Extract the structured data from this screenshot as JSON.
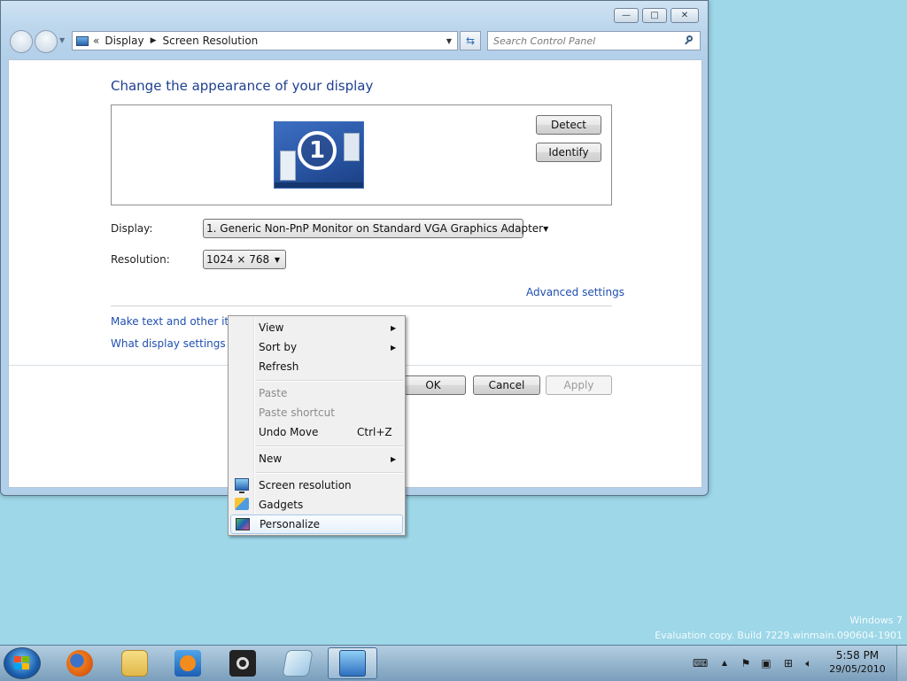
{
  "window": {
    "controls": {
      "minimize": "—",
      "maximize": "□",
      "close": "✕"
    },
    "address": {
      "chevron": "«",
      "breadcrumbs": [
        "Display",
        "Screen Resolution"
      ]
    },
    "search": {
      "placeholder": "Search Control Panel"
    }
  },
  "content": {
    "title": "Change the appearance of your display",
    "monitor_number": "1",
    "detect_label": "Detect",
    "identify_label": "Identify",
    "display_label": "Display:",
    "display_value": "1. Generic Non-PnP Monitor on Standard VGA Graphics Adapter",
    "resolution_label": "Resolution:",
    "resolution_value": "1024 × 768",
    "advanced_link": "Advanced settings",
    "link1": "Make text and other items",
    "link2": "What display settings sho",
    "ok_label": "OK",
    "cancel_label": "Cancel",
    "apply_label": "Apply"
  },
  "context_menu": {
    "items": [
      {
        "label": "View",
        "submenu": true
      },
      {
        "label": "Sort by",
        "submenu": true
      },
      {
        "label": "Refresh"
      },
      {
        "label": "Paste",
        "disabled": true
      },
      {
        "label": "Paste shortcut",
        "disabled": true
      },
      {
        "label": "Undo Move",
        "shortcut": "Ctrl+Z"
      },
      {
        "label": "New",
        "submenu": true
      },
      {
        "label": "Screen resolution",
        "icon": "screen-resolution-icon"
      },
      {
        "label": "Gadgets",
        "icon": "gadgets-icon"
      },
      {
        "label": "Personalize",
        "icon": "personalize-icon",
        "highlighted": true
      }
    ]
  },
  "watermark": {
    "line1": "Windows 7",
    "line2": "Evaluation copy. Build 7229.winmain.090604-1901"
  },
  "taskbar": {
    "apps": [
      "firefox-icon",
      "windows-explorer-icon",
      "media-player-icon",
      "camera-icon",
      "notepad-icon",
      "control-panel-icon"
    ],
    "clock": {
      "time": "5:58 PM",
      "date": "29/05/2010"
    }
  },
  "colors": {
    "desktop": "#9dd7e8",
    "link": "#1f4fb0",
    "title": "#1e3f91"
  }
}
